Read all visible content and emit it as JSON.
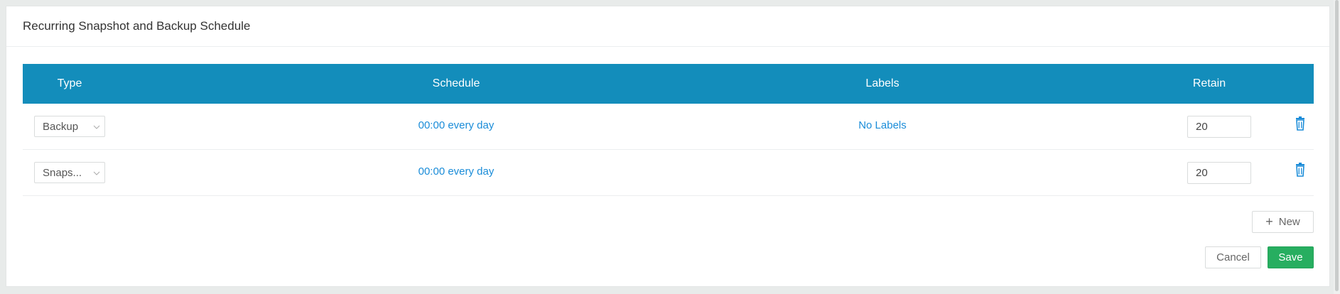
{
  "panel": {
    "title": "Recurring Snapshot and Backup Schedule"
  },
  "table": {
    "headers": {
      "type": "Type",
      "schedule": "Schedule",
      "labels": "Labels",
      "retain": "Retain"
    },
    "rows": [
      {
        "type": "Backup",
        "schedule": "00:00 every day",
        "labels": "No Labels",
        "retain": "20"
      },
      {
        "type": "Snaps...",
        "schedule": "00:00 every day",
        "labels": "",
        "retain": "20"
      }
    ]
  },
  "actions": {
    "new_label": "New",
    "cancel_label": "Cancel",
    "save_label": "Save"
  },
  "icons": {
    "chevron": "chevron-down-icon",
    "delete": "trash-icon",
    "add": "plus-icon"
  },
  "colors": {
    "header_bg": "#138dbb",
    "link": "#1a8cd8",
    "save_bg": "#27ae60"
  }
}
